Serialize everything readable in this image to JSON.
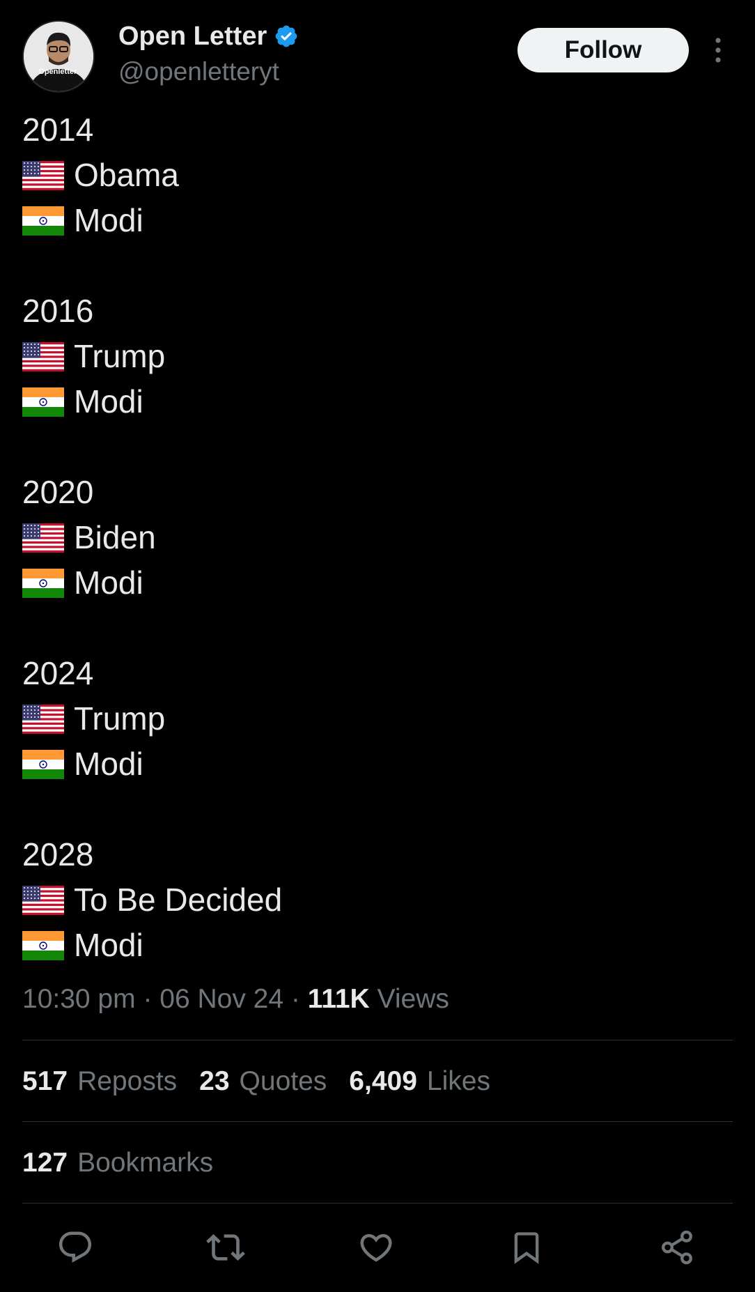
{
  "author": {
    "display_name": "Open Letter",
    "handle": "@openletteryt",
    "avatar_text": "Openletter.",
    "verified": true
  },
  "header": {
    "follow_label": "Follow"
  },
  "tweet": {
    "blocks": [
      {
        "year": "2014",
        "us": "Obama",
        "india": "Modi"
      },
      {
        "year": "2016",
        "us": "Trump",
        "india": "Modi"
      },
      {
        "year": "2020",
        "us": "Biden",
        "india": "Modi"
      },
      {
        "year": "2024",
        "us": "Trump",
        "india": "Modi"
      },
      {
        "year": "2028",
        "us": "To Be Decided",
        "india": "Modi"
      }
    ]
  },
  "meta": {
    "time": "10:30 pm",
    "date": "06 Nov 24",
    "views_count": "111K",
    "views_label": "Views"
  },
  "stats": {
    "reposts_count": "517",
    "reposts_label": "Reposts",
    "quotes_count": "23",
    "quotes_label": "Quotes",
    "likes_count": "6,409",
    "likes_label": "Likes",
    "bookmarks_count": "127",
    "bookmarks_label": "Bookmarks"
  },
  "actions": [
    "reply-icon",
    "repost-icon",
    "like-icon",
    "bookmark-icon",
    "share-icon"
  ],
  "colors": {
    "background": "#000000",
    "text": "#e7e9ea",
    "secondary_text": "#71767b",
    "divider": "#2f3336",
    "verified": "#1d9bf0",
    "follow_bg": "#eff3f4"
  }
}
